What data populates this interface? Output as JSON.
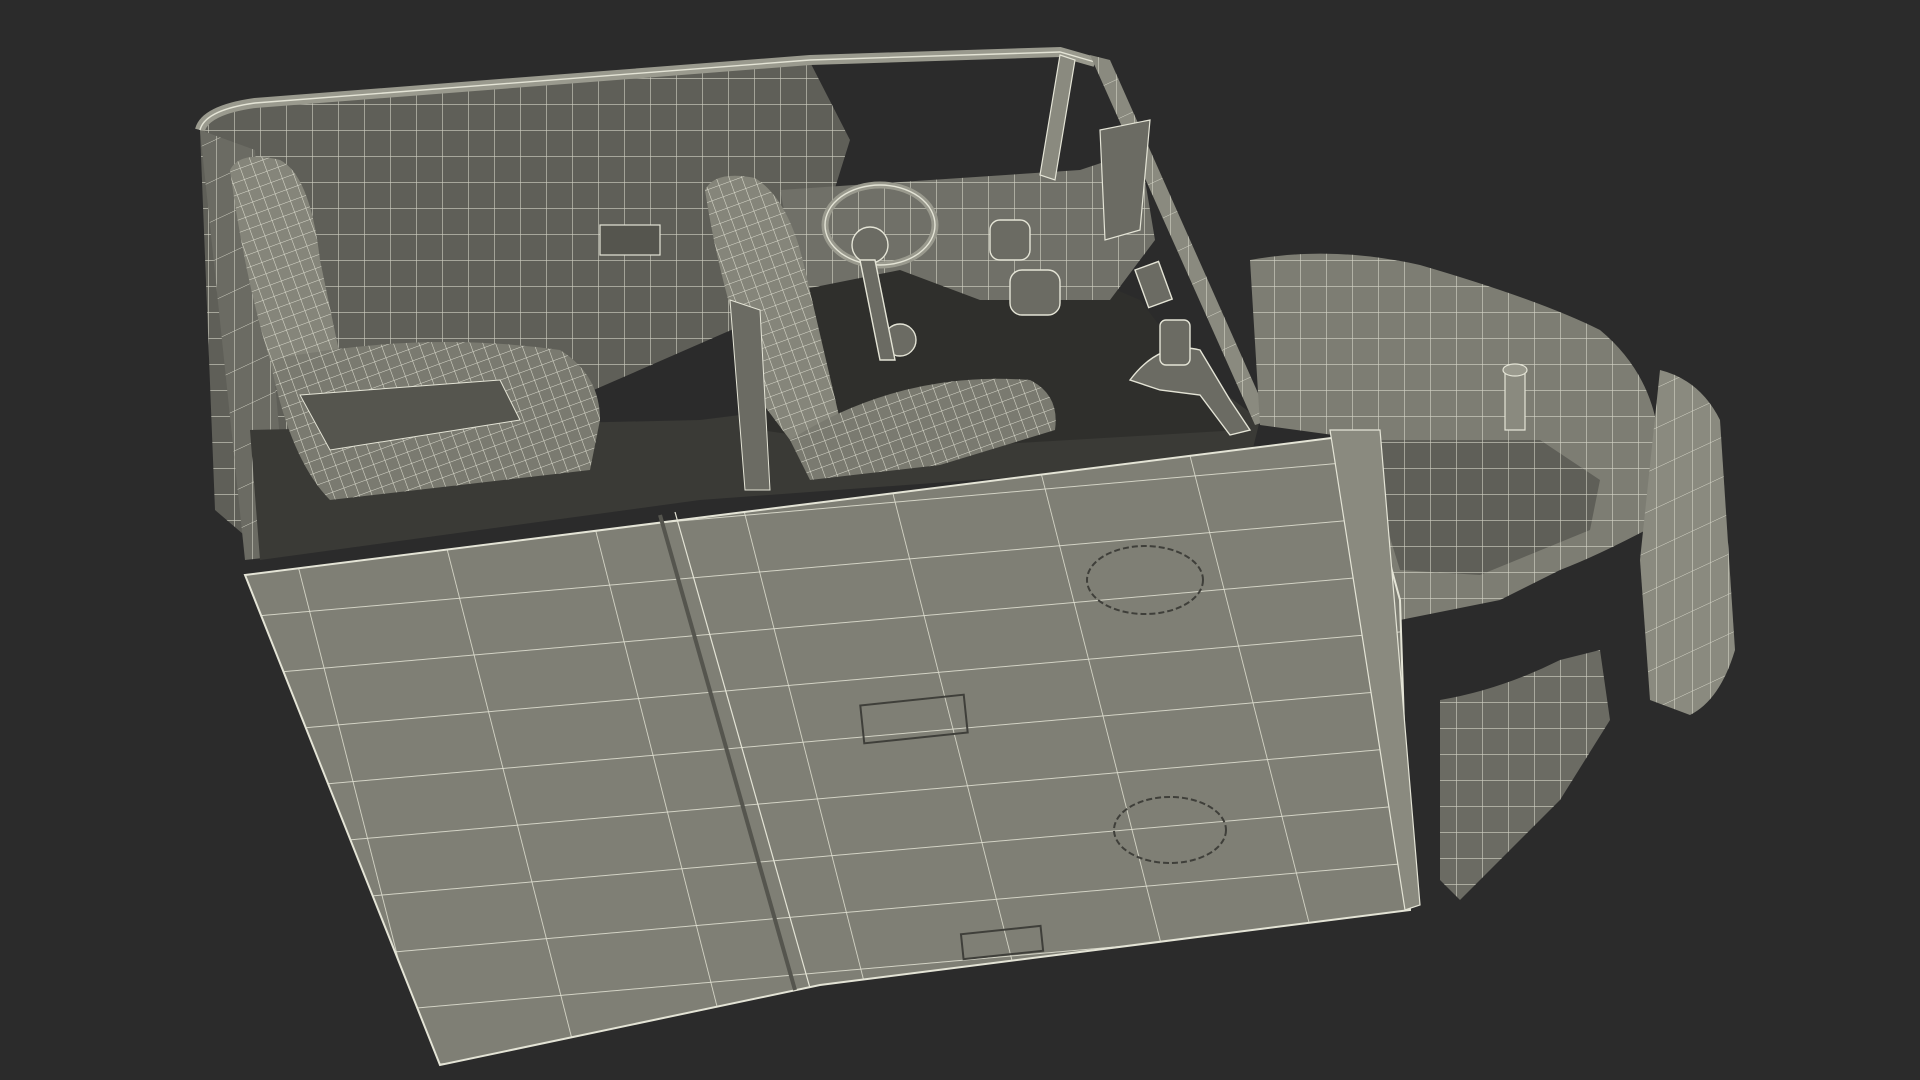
{
  "scene": {
    "subject": "",
    "render_style": "wireframe-over-shaded",
    "colors": {
      "background": "#2b2b2b",
      "surface_light": "#85857a",
      "surface_mid": "#6f6f66",
      "surface_dark": "#55554e",
      "interior_shadow": "#3a3a36",
      "wire": "#e4e4d6"
    },
    "parts": [
      "cabin-shell",
      "floor-pan",
      "driver-seat",
      "passenger-seat",
      "dashboard",
      "steering-column",
      "windshield-frame",
      "front-wheel-well",
      "rear-panel"
    ]
  }
}
